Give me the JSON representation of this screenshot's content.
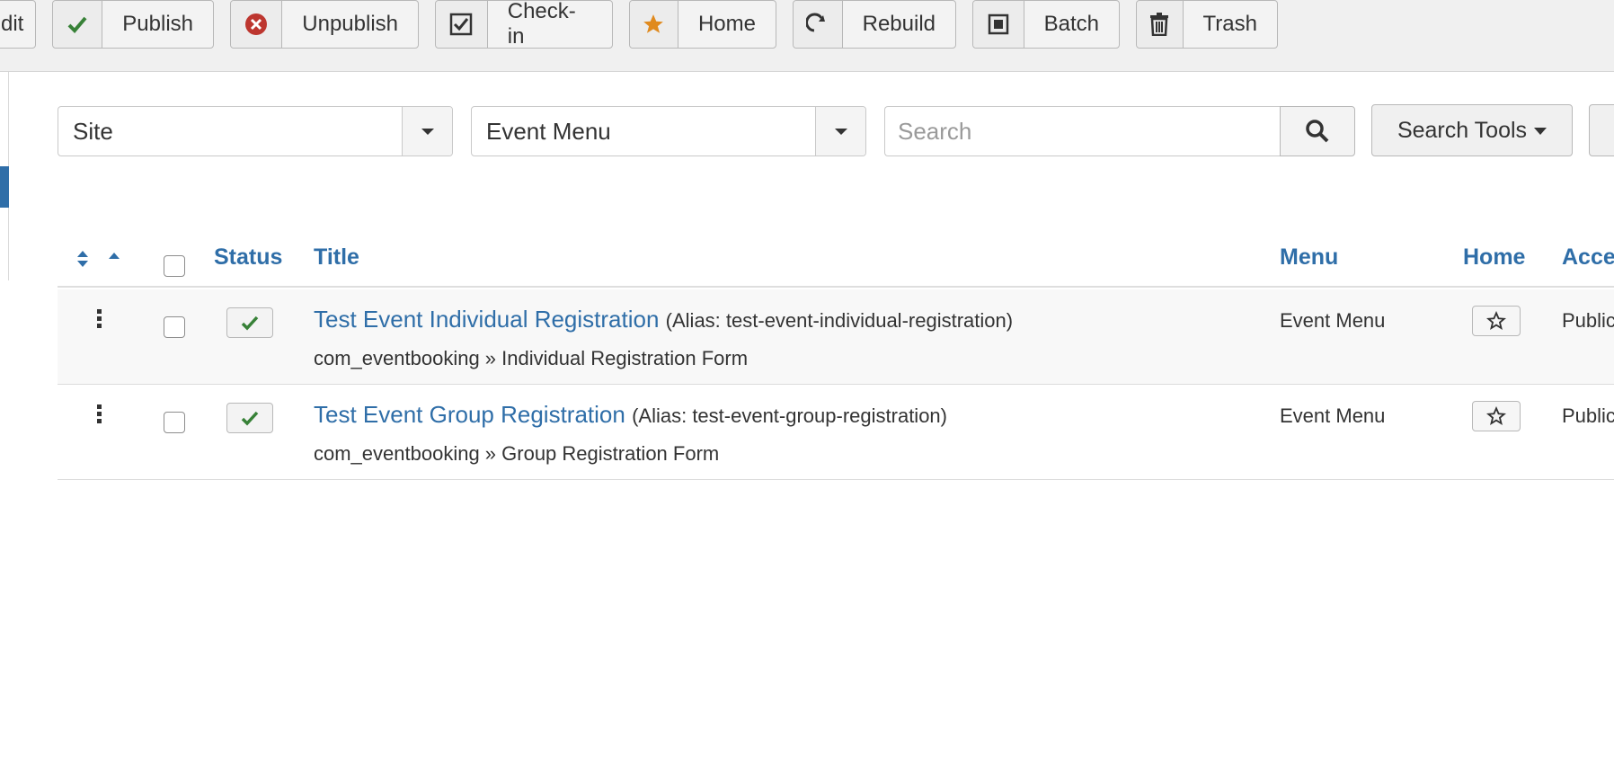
{
  "toolbar": {
    "edit_label": "dit",
    "publish_label": "Publish",
    "unpublish_label": "Unpublish",
    "checkin_label": "Check-in",
    "home_label": "Home",
    "rebuild_label": "Rebuild",
    "batch_label": "Batch",
    "trash_label": "Trash"
  },
  "filters": {
    "site_value": "Site",
    "menu_value": "Event Menu",
    "search_placeholder": "Search",
    "search_tools_label": "Search Tools"
  },
  "table": {
    "headers": {
      "status": "Status",
      "title": "Title",
      "menu": "Menu",
      "home": "Home",
      "access": "Acce"
    },
    "rows": [
      {
        "title": "Test Event Individual Registration",
        "alias": "(Alias: test-event-individual-registration)",
        "type": "com_eventbooking » Individual Registration Form",
        "menu": "Event Menu",
        "access": "Public"
      },
      {
        "title": "Test Event Group Registration",
        "alias": "(Alias: test-event-group-registration)",
        "type": "com_eventbooking » Group Registration Form",
        "menu": "Event Menu",
        "access": "Public"
      }
    ]
  },
  "colors": {
    "link": "#2f6ea8",
    "publish_check": "#378137",
    "unpublish_red": "#bd362f",
    "home_star": "#e08a1e"
  }
}
